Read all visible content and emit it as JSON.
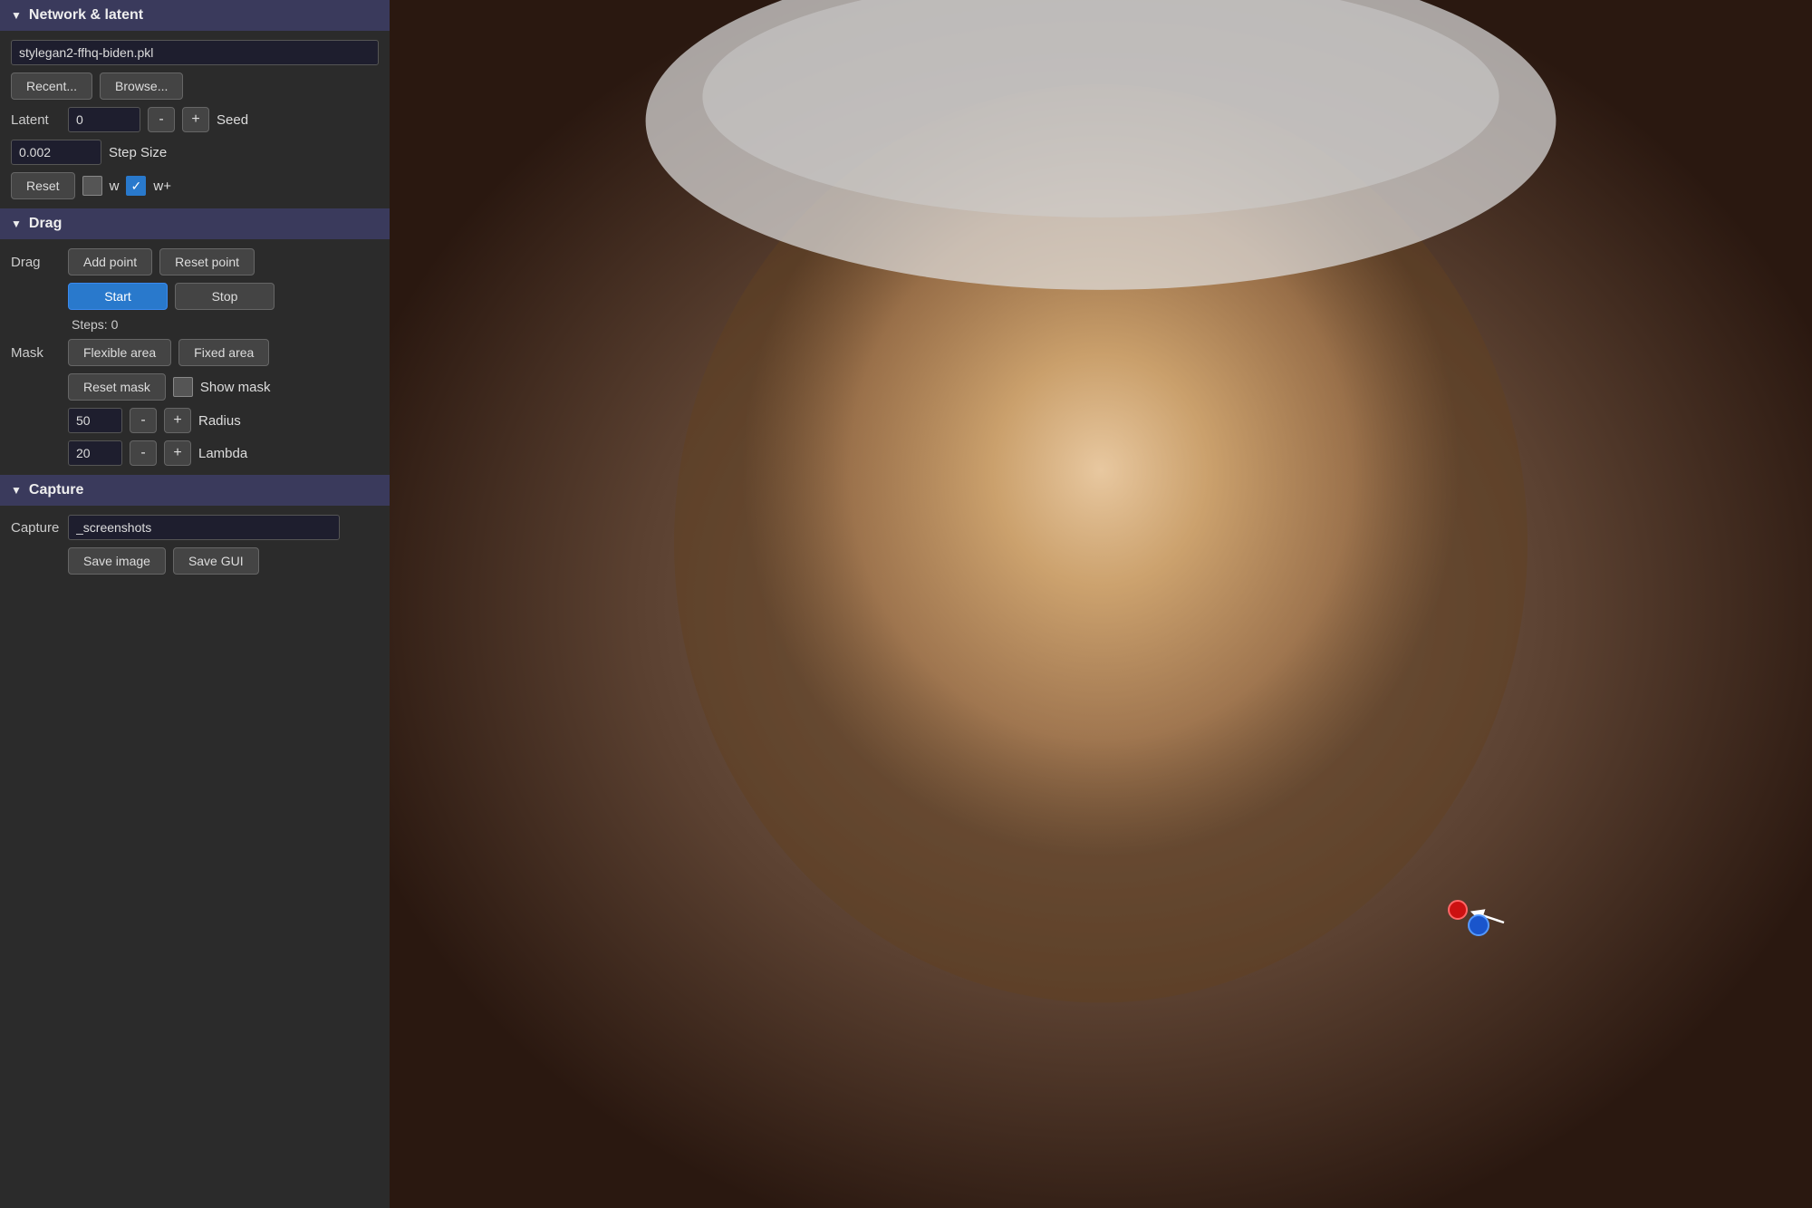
{
  "network_section": {
    "title": "Network & latent",
    "pickle_label": "",
    "pickle_value": "stylegan2-ffhq-biden.pkl",
    "recent_button": "Recent...",
    "browse_button": "Browse...",
    "latent_label": "Latent",
    "latent_value": "0",
    "minus_label": "-",
    "plus_label": "+",
    "seed_label": "Seed",
    "step_size_value": "0.002",
    "step_size_label": "Step Size",
    "reset_button": "Reset",
    "w_label": "w",
    "wplus_label": "w+"
  },
  "drag_section": {
    "title": "Drag",
    "drag_label": "Drag",
    "add_point_button": "Add point",
    "reset_point_button": "Reset point",
    "start_button": "Start",
    "stop_button": "Stop",
    "steps_label": "Steps: 0",
    "mask_label": "Mask",
    "flexible_area_button": "Flexible area",
    "fixed_area_button": "Fixed area",
    "reset_mask_button": "Reset mask",
    "show_mask_label": "Show mask",
    "radius_value": "50",
    "radius_minus": "-",
    "radius_plus": "+",
    "radius_label": "Radius",
    "lambda_value": "20",
    "lambda_minus": "-",
    "lambda_plus": "+",
    "lambda_label": "Lambda"
  },
  "capture_section": {
    "title": "Capture",
    "capture_label": "Capture",
    "capture_value": "_screenshots",
    "save_image_button": "Save image",
    "save_gui_button": "Save GUI"
  }
}
